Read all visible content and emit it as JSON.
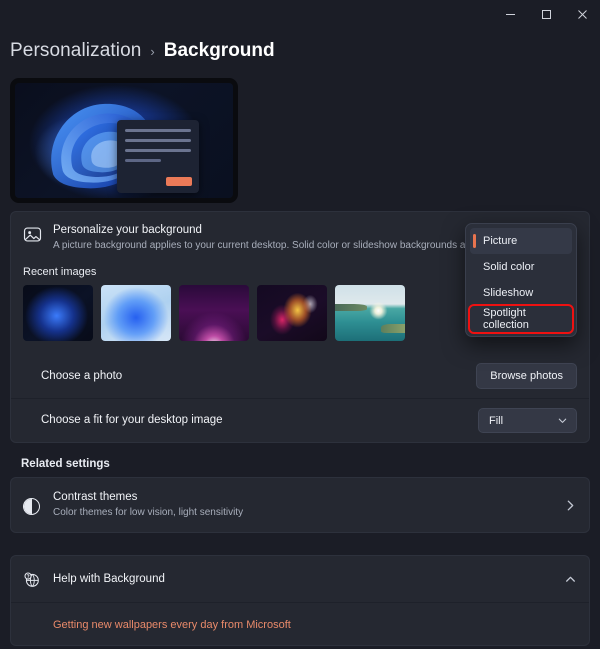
{
  "window": {
    "minimize_label": "Minimize",
    "maximize_label": "Maximize",
    "close_label": "Close"
  },
  "breadcrumb": {
    "parent": "Personalization",
    "separator": "›",
    "current": "Background"
  },
  "preview": {
    "name": "desktop-background-preview",
    "wallpaper": "windows-11-bloom-blue",
    "dialog_button_color": "#eb7a58"
  },
  "personalize": {
    "icon": "picture-icon",
    "title": "Personalize your background",
    "description": "A picture background applies to your current desktop. Solid color or slideshow backgrounds apply to all your desktops.",
    "dropdown": {
      "selected": "Picture",
      "options": [
        {
          "label": "Picture",
          "selected": true,
          "highlighted": false
        },
        {
          "label": "Solid color",
          "selected": false,
          "highlighted": false
        },
        {
          "label": "Slideshow",
          "selected": false,
          "highlighted": false
        },
        {
          "label": "Spotlight collection",
          "selected": false,
          "highlighted": true
        }
      ],
      "selection_accent": "#e8744f",
      "highlight_color": "#ee1111"
    }
  },
  "recent_images": {
    "label": "Recent images",
    "items": [
      {
        "name": "bloom-dark-blue"
      },
      {
        "name": "bloom-light-blue"
      },
      {
        "name": "purple-glow-arc"
      },
      {
        "name": "abstract-flower-warm"
      },
      {
        "name": "teal-seascape-sunrise"
      }
    ]
  },
  "choose_photo": {
    "label": "Choose a photo",
    "button_label": "Browse photos"
  },
  "choose_fit": {
    "label": "Choose a fit for your desktop image",
    "value": "Fill",
    "chevron": "chevron-down-icon"
  },
  "related_settings": {
    "section_label": "Related settings",
    "contrast_themes": {
      "icon": "contrast-circle-icon",
      "title": "Contrast themes",
      "subtitle": "Color themes for low vision, light sensitivity",
      "chevron": "chevron-right-icon"
    }
  },
  "help": {
    "icon": "help-globe-icon",
    "title": "Help with Background",
    "chevron": "chevron-up-icon",
    "links": [
      "Getting new wallpapers every day from Microsoft"
    ]
  },
  "colors": {
    "page_bg": "#1b1d26",
    "card_bg": "#252831",
    "control_bg": "#343845",
    "accent_link": "#e98a6a",
    "annotation_red": "#ee1111"
  }
}
